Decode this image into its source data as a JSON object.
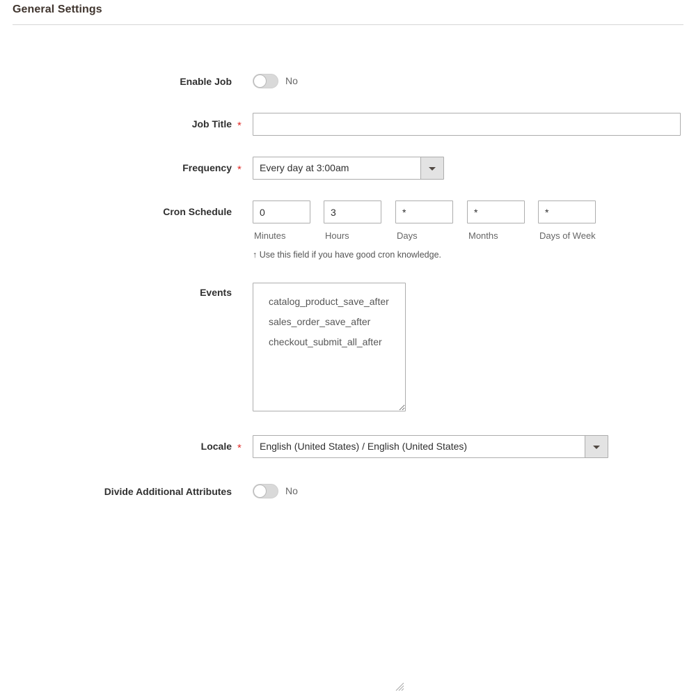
{
  "section": {
    "title": "General Settings"
  },
  "fields": {
    "enable_job": {
      "label": "Enable Job",
      "toggle_state": "off",
      "state_text": "No"
    },
    "job_title": {
      "label": "Job Title",
      "required_marker": "*",
      "value": "",
      "placeholder": ""
    },
    "frequency": {
      "label": "Frequency",
      "required_marker": "*",
      "selected": "Every day at 3:00am"
    },
    "cron_schedule": {
      "label": "Cron Schedule",
      "inputs": [
        {
          "value": "0",
          "sub_label": "Minutes"
        },
        {
          "value": "3",
          "sub_label": "Hours"
        },
        {
          "value": "*",
          "sub_label": "Days"
        },
        {
          "value": "*",
          "sub_label": "Months"
        },
        {
          "value": "*",
          "sub_label": "Days of Week"
        }
      ],
      "note": "↑ Use this field if you have good cron knowledge."
    },
    "events": {
      "label": "Events",
      "value": "catalog_product_save_after\nsales_order_save_after\ncheckout_submit_all_after"
    },
    "locale": {
      "label": "Locale",
      "required_marker": "*",
      "selected": "English (United States) / English (United States)"
    },
    "divide_additional_attributes": {
      "label": "Divide Additional Attributes",
      "toggle_state": "off",
      "state_text": "No"
    }
  },
  "colors": {
    "required_star": "#e02b27",
    "title": "#41362f",
    "label": "#303030",
    "border": "#adadad",
    "rule": "#d6d6d6",
    "select_button": "#e3e3e3",
    "toggle_track": "#d9d9d9"
  }
}
